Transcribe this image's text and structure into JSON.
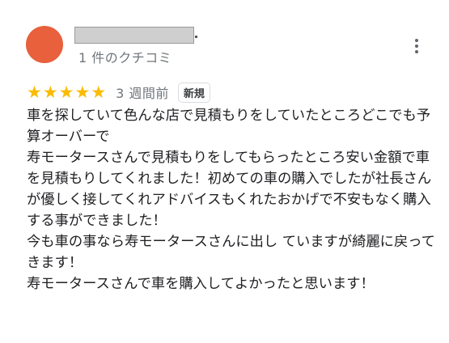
{
  "review": {
    "review_count": "1 件のクチコミ",
    "rating": 5,
    "max_rating": 5,
    "star_glyph": "★",
    "time_ago": "3 週間前",
    "badge": "新規",
    "more_icon": "more-vertical-icon",
    "avatar_color": "#e8603c",
    "star_color": "#fbbc04",
    "text": "車を探していて色んな店で見積もりをしていたところどこでも予算オーバーで\n寿モータースさんで見積もりをしてもらったところ安い金額で車を見積もりしてくれました！初めての車の購入でしたが社長さんが優しく接してくれアドバイスもくれたおかげで不安もなく購入する事ができました！\n今も車の事なら寿モータースさんに出し ていますが綺麗に戻ってきます！\n寿モータースさんで車を購入してよかったと思います！"
  }
}
